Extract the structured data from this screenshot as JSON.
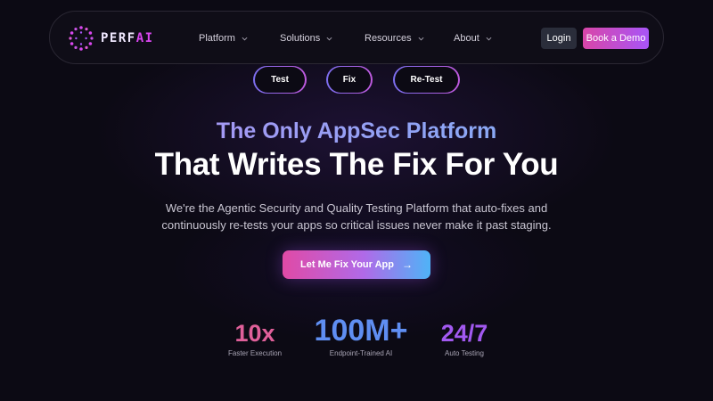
{
  "brand": {
    "logo_prefix": "PERF",
    "logo_suffix": "AI",
    "accent": "#d946ef"
  },
  "nav": {
    "items": [
      {
        "label": "Platform"
      },
      {
        "label": "Solutions"
      },
      {
        "label": "Resources"
      },
      {
        "label": "About"
      }
    ],
    "login_label": "Login",
    "demo_label": "Book a Demo"
  },
  "pills": [
    {
      "label": "Test"
    },
    {
      "label": "Fix"
    },
    {
      "label": "Re-Test"
    }
  ],
  "hero": {
    "headline_1": "The Only AppSec Platform",
    "headline_2": "That Writes The Fix For You",
    "subtext_line_1": "We're the Agentic Security and Quality Testing Platform that auto-fixes and",
    "subtext_line_2": "continuously re-tests your apps so critical issues never make it past staging.",
    "cta_label": "Let Me Fix Your App",
    "cta_icon": "arrow-right-icon"
  },
  "stats": [
    {
      "value": "10x",
      "label": "Faster Execution",
      "color": "#e0609a"
    },
    {
      "value": "100M+",
      "label": "Endpoint-Trained AI",
      "color": "#5f8ef2"
    },
    {
      "value": "24/7",
      "label": "Auto Testing",
      "color": "#a259f0"
    }
  ]
}
